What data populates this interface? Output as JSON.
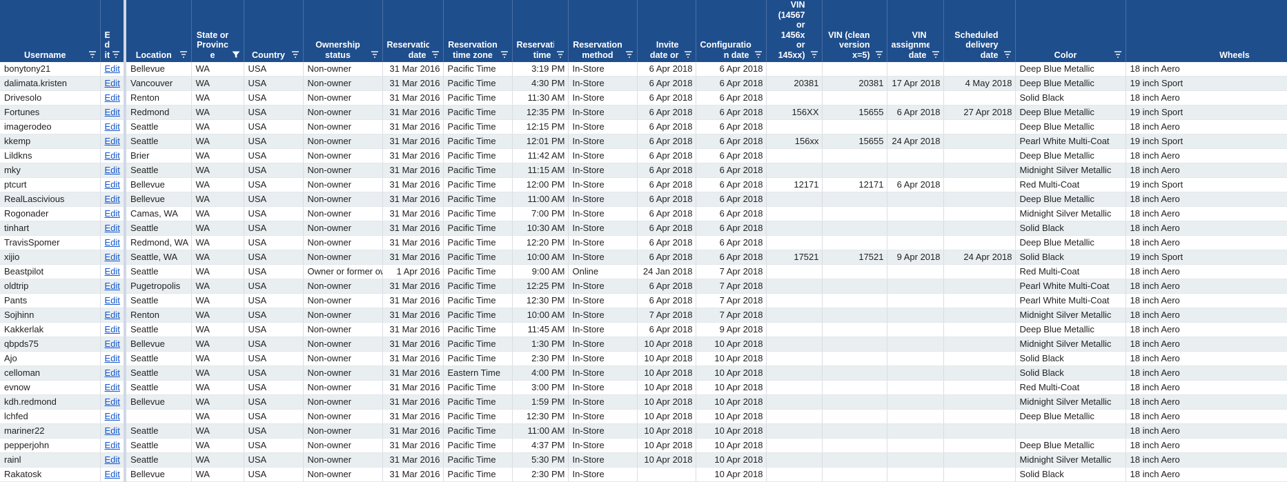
{
  "columns": [
    {
      "label": "Username",
      "align": "l",
      "filter": "lines"
    },
    {
      "label": "E d it",
      "align": "l",
      "filter": "lines"
    },
    {
      "label": "Location",
      "align": "l",
      "filter": "lines"
    },
    {
      "label": "State or Provinc e",
      "align": "l",
      "filter": "funnel"
    },
    {
      "label": "Country",
      "align": "l",
      "filter": "lines"
    },
    {
      "label": "Ownership status",
      "align": "l",
      "filter": "lines"
    },
    {
      "label": "Reservation date",
      "align": "r",
      "filter": "lines"
    },
    {
      "label": "Reservation time zone",
      "align": "l",
      "filter": "lines"
    },
    {
      "label": "Reservation time",
      "align": "r",
      "filter": "lines"
    },
    {
      "label": "Reservation method",
      "align": "l",
      "filter": "lines"
    },
    {
      "label": "Invite date or",
      "align": "r",
      "filter": "lines"
    },
    {
      "label": "Configuratio n date",
      "align": "r",
      "filter": "lines"
    },
    {
      "label": "VIN (14567 or 1456x or 145xx)",
      "align": "r",
      "filter": "lines"
    },
    {
      "label": "VIN (clean version x=5)",
      "align": "r",
      "filter": "lines"
    },
    {
      "label": "VIN assignment date",
      "align": "r",
      "filter": "lines"
    },
    {
      "label": "Scheduled delivery date",
      "align": "r",
      "filter": "lines"
    },
    {
      "label": "Color",
      "align": "l",
      "filter": "lines"
    },
    {
      "label": "Wheels",
      "align": "l",
      "filter": "none"
    }
  ],
  "edit_label": "Edit",
  "rows": [
    [
      "bonytony21",
      "Edit",
      "Bellevue",
      "WA",
      "USA",
      "Non-owner",
      "31 Mar 2016",
      "Pacific Time",
      "3:19 PM",
      "In-Store",
      "6 Apr 2018",
      "6 Apr 2018",
      "",
      "",
      "",
      "",
      "Deep Blue Metallic",
      "18 inch Aero"
    ],
    [
      "dalimata.kristen",
      "Edit",
      "Vancouver",
      "WA",
      "USA",
      "Non-owner",
      "31 Mar 2016",
      "Pacific Time",
      "4:30 PM",
      "In-Store",
      "6 Apr 2018",
      "6 Apr 2018",
      "20381",
      "20381",
      "17 Apr 2018",
      "4 May 2018",
      "Deep Blue Metallic",
      "19 inch Sport"
    ],
    [
      "Drivesolo",
      "Edit",
      "Renton",
      "WA",
      "USA",
      "Non-owner",
      "31 Mar 2016",
      "Pacific Time",
      "11:30 AM",
      "In-Store",
      "6 Apr 2018",
      "6 Apr 2018",
      "",
      "",
      "",
      "",
      "Solid Black",
      "18 inch Aero"
    ],
    [
      "Fortunes",
      "Edit",
      "Redmond",
      "WA",
      "USA",
      "Non-owner",
      "31 Mar 2016",
      "Pacific Time",
      "12:35 PM",
      "In-Store",
      "6 Apr 2018",
      "6 Apr 2018",
      "156XX",
      "15655",
      "6 Apr 2018",
      "27 Apr 2018",
      "Deep Blue Metallic",
      "19 inch Sport"
    ],
    [
      "imagerodeo",
      "Edit",
      "Seattle",
      "WA",
      "USA",
      "Non-owner",
      "31 Mar 2016",
      "Pacific Time",
      "12:15 PM",
      "In-Store",
      "6 Apr 2018",
      "6 Apr 2018",
      "",
      "",
      "",
      "",
      "Deep Blue Metallic",
      "18 inch Aero"
    ],
    [
      "kkemp",
      "Edit",
      "Seattle",
      "WA",
      "USA",
      "Non-owner",
      "31 Mar 2016",
      "Pacific Time",
      "12:01 PM",
      "In-Store",
      "6 Apr 2018",
      "6 Apr 2018",
      "156xx",
      "15655",
      "24 Apr 2018",
      "",
      "Pearl White Multi-Coat",
      "19 inch Sport"
    ],
    [
      "Lildkns",
      "Edit",
      "Brier",
      "WA",
      "USA",
      "Non-owner",
      "31 Mar 2016",
      "Pacific Time",
      "11:42 AM",
      "In-Store",
      "6 Apr 2018",
      "6 Apr 2018",
      "",
      "",
      "",
      "",
      "Deep Blue Metallic",
      "18 inch Aero"
    ],
    [
      "mky",
      "Edit",
      "Seattle",
      "WA",
      "USA",
      "Non-owner",
      "31 Mar 2016",
      "Pacific Time",
      "11:15 AM",
      "In-Store",
      "6 Apr 2018",
      "6 Apr 2018",
      "",
      "",
      "",
      "",
      "Midnight Silver Metallic",
      "18 inch Aero"
    ],
    [
      "ptcurt",
      "Edit",
      "Bellevue",
      "WA",
      "USA",
      "Non-owner",
      "31 Mar 2016",
      "Pacific Time",
      "12:00 PM",
      "In-Store",
      "6 Apr 2018",
      "6 Apr 2018",
      "12171",
      "12171",
      "6 Apr 2018",
      "",
      "Red Multi-Coat",
      "19 inch Sport"
    ],
    [
      "RealLascivious",
      "Edit",
      "Bellevue",
      "WA",
      "USA",
      "Non-owner",
      "31 Mar 2016",
      "Pacific Time",
      "11:00 AM",
      "In-Store",
      "6 Apr 2018",
      "6 Apr 2018",
      "",
      "",
      "",
      "",
      "Deep Blue Metallic",
      "18 inch Aero"
    ],
    [
      "Rogonader",
      "Edit",
      "Camas, WA",
      "WA",
      "USA",
      "Non-owner",
      "31 Mar 2016",
      "Pacific Time",
      "7:00 PM",
      "In-Store",
      "6 Apr 2018",
      "6 Apr 2018",
      "",
      "",
      "",
      "",
      "Midnight Silver Metallic",
      "18 inch Aero"
    ],
    [
      "tinhart",
      "Edit",
      "Seattle",
      "WA",
      "USA",
      "Non-owner",
      "31 Mar 2016",
      "Pacific Time",
      "10:30 AM",
      "In-Store",
      "6 Apr 2018",
      "6 Apr 2018",
      "",
      "",
      "",
      "",
      "Solid Black",
      "18 inch Aero"
    ],
    [
      "TravisSpomer",
      "Edit",
      "Redmond, WA",
      "WA",
      "USA",
      "Non-owner",
      "31 Mar 2016",
      "Pacific Time",
      "12:20 PM",
      "In-Store",
      "6 Apr 2018",
      "6 Apr 2018",
      "",
      "",
      "",
      "",
      "Deep Blue Metallic",
      "18 inch Aero"
    ],
    [
      "xijio",
      "Edit",
      "Seattle, WA",
      "WA",
      "USA",
      "Non-owner",
      "31 Mar 2016",
      "Pacific Time",
      "10:00 AM",
      "In-Store",
      "6 Apr 2018",
      "6 Apr 2018",
      "17521",
      "17521",
      "9 Apr 2018",
      "24 Apr 2018",
      "Solid Black",
      "19 inch Sport"
    ],
    [
      "Beastpilot",
      "Edit",
      "Seattle",
      "WA",
      "USA",
      "Owner or former ow",
      "1 Apr 2016",
      "Pacific Time",
      "9:00 AM",
      "Online",
      "24 Jan 2018",
      "7 Apr 2018",
      "",
      "",
      "",
      "",
      "Red Multi-Coat",
      "18 inch Aero"
    ],
    [
      "oldtrip",
      "Edit",
      "Pugetropolis",
      "WA",
      "USA",
      "Non-owner",
      "31 Mar 2016",
      "Pacific Time",
      "12:25 PM",
      "In-Store",
      "6 Apr 2018",
      "7 Apr 2018",
      "",
      "",
      "",
      "",
      "Pearl White Multi-Coat",
      "18 inch Aero"
    ],
    [
      "Pants",
      "Edit",
      "Seattle",
      "WA",
      "USA",
      "Non-owner",
      "31 Mar 2016",
      "Pacific Time",
      "12:30 PM",
      "In-Store",
      "6 Apr 2018",
      "7 Apr 2018",
      "",
      "",
      "",
      "",
      "Pearl White Multi-Coat",
      "18 inch Aero"
    ],
    [
      "Sojhinn",
      "Edit",
      "Renton",
      "WA",
      "USA",
      "Non-owner",
      "31 Mar 2016",
      "Pacific Time",
      "10:00 AM",
      "In-Store",
      "7 Apr 2018",
      "7 Apr 2018",
      "",
      "",
      "",
      "",
      "Midnight Silver Metallic",
      "18 inch Aero"
    ],
    [
      "Kakkerlak",
      "Edit",
      "Seattle",
      "WA",
      "USA",
      "Non-owner",
      "31 Mar 2016",
      "Pacific Time",
      "11:45 AM",
      "In-Store",
      "6 Apr 2018",
      "9 Apr 2018",
      "",
      "",
      "",
      "",
      "Deep Blue Metallic",
      "18 inch Aero"
    ],
    [
      " qbpds75",
      "Edit",
      "Bellevue",
      "WA",
      "USA",
      "Non-owner",
      "31 Mar 2016",
      "Pacific Time",
      "1:30 PM",
      "In-Store",
      "10 Apr 2018",
      "10 Apr 2018",
      "",
      "",
      "",
      "",
      "Midnight Silver Metallic",
      "18 inch Aero"
    ],
    [
      "Ajo",
      "Edit",
      "Seattle",
      "WA",
      "USA",
      "Non-owner",
      "31 Mar 2016",
      "Pacific Time",
      "2:30 PM",
      "In-Store",
      "10 Apr 2018",
      "10 Apr 2018",
      "",
      "",
      "",
      "",
      "Solid Black",
      "18 inch Aero"
    ],
    [
      "celloman",
      "Edit",
      "Seattle",
      "WA",
      "USA",
      "Non-owner",
      "31 Mar 2016",
      "Eastern Time",
      "4:00 PM",
      "In-Store",
      "10 Apr 2018",
      "10 Apr 2018",
      "",
      "",
      "",
      "",
      "Solid Black",
      "18 inch Aero"
    ],
    [
      "evnow",
      "Edit",
      "Seattle",
      "WA",
      "USA",
      "Non-owner",
      "31 Mar 2016",
      "Pacific Time",
      "3:00 PM",
      "In-Store",
      "10 Apr 2018",
      "10 Apr 2018",
      "",
      "",
      "",
      "",
      "Red Multi-Coat",
      "18 inch Aero"
    ],
    [
      "kdh.redmond",
      "Edit",
      "Bellevue",
      "WA",
      "USA",
      "Non-owner",
      "31 Mar 2016",
      "Pacific Time",
      "1:59 PM",
      "In-Store",
      "10 Apr 2018",
      "10 Apr 2018",
      "",
      "",
      "",
      "",
      "Midnight Silver Metallic",
      "18 inch Aero"
    ],
    [
      "lchfed",
      "Edit",
      "",
      "WA",
      "USA",
      "Non-owner",
      "31 Mar 2016",
      "Pacific Time",
      "12:30 PM",
      "In-Store",
      "10 Apr 2018",
      "10 Apr 2018",
      "",
      "",
      "",
      "",
      "Deep Blue Metallic",
      "18 inch Aero"
    ],
    [
      "mariner22",
      "Edit",
      "Seattle",
      "WA",
      "USA",
      "Non-owner",
      "31 Mar 2016",
      "Pacific Time",
      "11:00 AM",
      "In-Store",
      "10 Apr 2018",
      "10 Apr 2018",
      "",
      "",
      "",
      "",
      "",
      "18 inch Aero"
    ],
    [
      "pepperjohn",
      "Edit",
      "Seattle",
      "WA",
      "USA",
      "Non-owner",
      "31 Mar 2016",
      "Pacific Time",
      "4:37 PM",
      "In-Store",
      "10 Apr 2018",
      "10 Apr 2018",
      "",
      "",
      "",
      "",
      "Deep Blue Metallic",
      "18 inch Aero"
    ],
    [
      "rainl",
      "Edit",
      "Seattle",
      "WA",
      "USA",
      "Non-owner",
      "31 Mar 2016",
      "Pacific Time",
      "5:30 PM",
      "In-Store",
      "10 Apr 2018",
      "10 Apr 2018",
      "",
      "",
      "",
      "",
      "Midnight Silver Metallic",
      "18 inch Aero"
    ],
    [
      "Rakatosk",
      "Edit",
      "Bellevue",
      "WA",
      "USA",
      "Non-owner",
      "31 Mar 2016",
      "Pacific Time",
      "2:30 PM",
      "In-Store",
      "",
      "10 Apr 2018",
      "",
      "",
      "",
      "",
      "Solid Black",
      "18 inch Aero"
    ]
  ],
  "colors": {
    "header_bg": "#1f4e8c",
    "header_text": "#ffffff",
    "row_alt": "#e9eef1",
    "link": "#1155cc"
  }
}
